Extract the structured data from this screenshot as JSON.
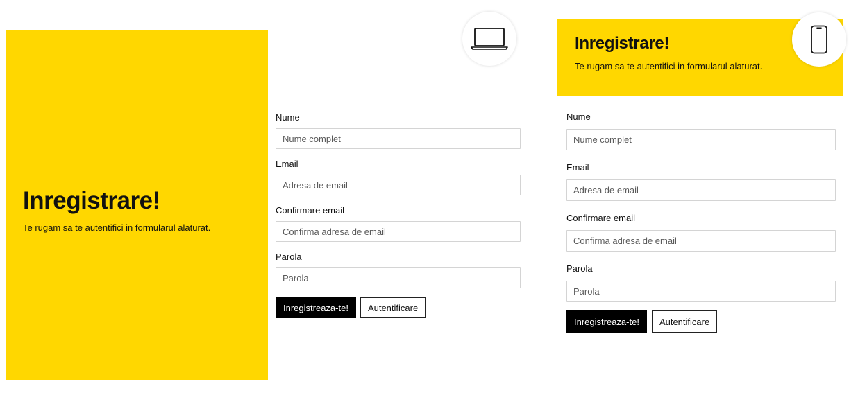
{
  "desktop": {
    "hero": {
      "title": "Inregistrare!",
      "subtitle": "Te rugam sa te autentifici in formularul alaturat."
    },
    "device_icon": "laptop-icon"
  },
  "mobile": {
    "hero": {
      "title": "Inregistrare!",
      "subtitle": "Te rugam sa te autentifici in formularul alaturat."
    },
    "device_icon": "smartphone-icon"
  },
  "form": {
    "fields": [
      {
        "label": "Nume",
        "placeholder": "Nume complet"
      },
      {
        "label": "Email",
        "placeholder": "Adresa de email"
      },
      {
        "label": "Confirmare email",
        "placeholder": "Confirma adresa de email"
      },
      {
        "label": "Parola",
        "placeholder": "Parola"
      }
    ],
    "register_label": "Inregistreaza-te!",
    "login_label": "Autentificare"
  },
  "colors": {
    "accent": "#FFD700",
    "primary_button": "#000000",
    "divider": "#222222"
  }
}
